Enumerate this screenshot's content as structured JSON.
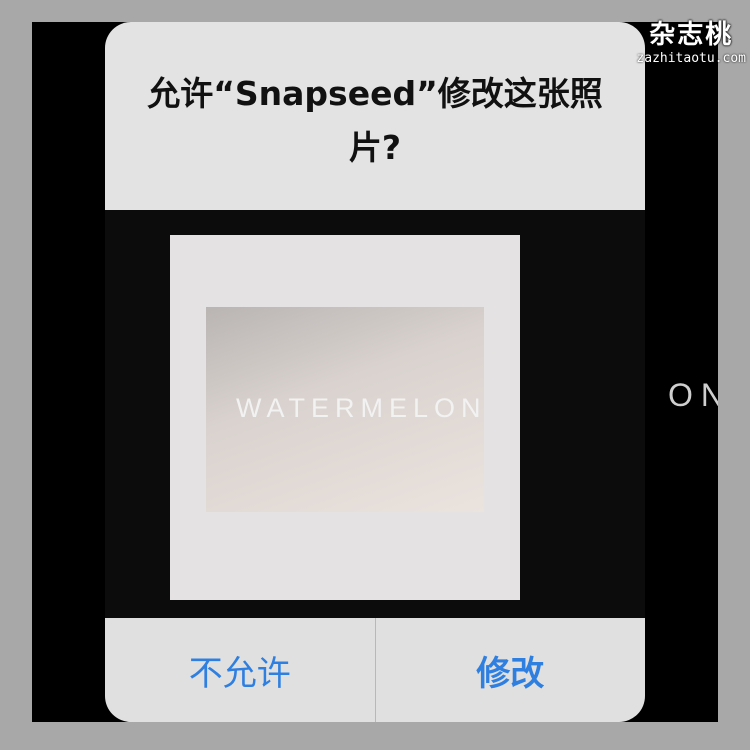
{
  "dialog": {
    "title": "允许“Snapseed”修改这张照片?",
    "deny_label": "不允许",
    "allow_label": "修改",
    "accent": "#2f7fe0"
  },
  "photo": {
    "watermark_text": "WATERMELON",
    "background_partial_text": "ON"
  },
  "site_watermark": {
    "logo": "杂志桃",
    "url": "zazhitaotu.com"
  }
}
